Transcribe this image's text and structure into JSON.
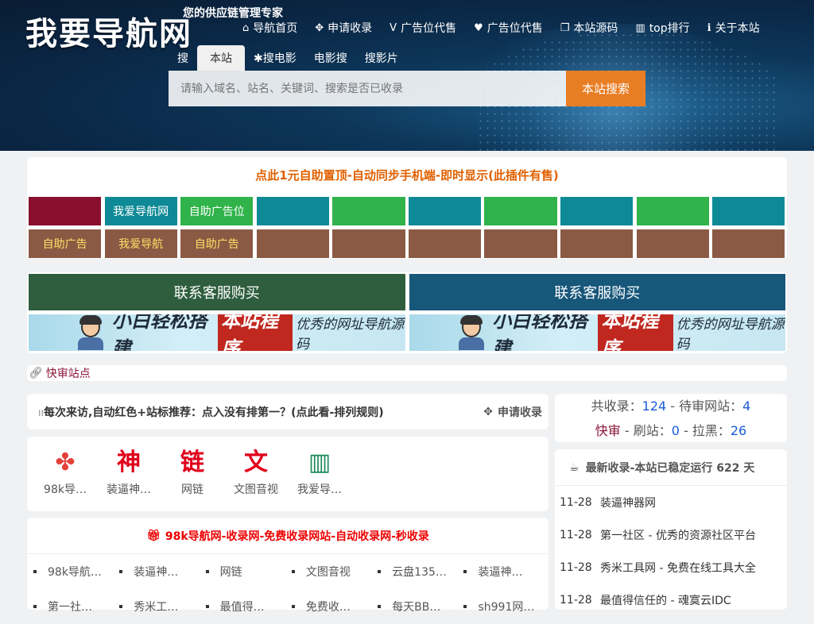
{
  "header": {
    "logo": "我要导航网",
    "slogan": "您的供应链管理专家",
    "nav": [
      {
        "icon": "home-icon",
        "glyph": "⌂",
        "label": "导航首页"
      },
      {
        "icon": "move-icon",
        "glyph": "✥",
        "label": "申请收录"
      },
      {
        "icon": "vimeo-icon",
        "glyph": "V",
        "label": "广告位代售"
      },
      {
        "icon": "heart-icon",
        "glyph": "♥",
        "label": "广告位代售"
      },
      {
        "icon": "window-icon",
        "glyph": "❐",
        "label": "本站源码"
      },
      {
        "icon": "chart-icon",
        "glyph": "▥",
        "label": "top排行"
      },
      {
        "icon": "info-icon",
        "glyph": "ℹ",
        "label": "关于本站"
      }
    ],
    "search_tabs": [
      "搜",
      "本站",
      "✱搜电影",
      "电影搜",
      "搜影片"
    ],
    "search_placeholder": "请输入域名、站名、关键词、搜索是否已收录",
    "search_button": "本站搜索"
  },
  "ad_title": "点此1元自助置顶-自动同步手机端-即时显示(此插件有售)",
  "ad_grid": [
    {
      "label": "",
      "color": "#8a0f2e"
    },
    {
      "label": "我爱导航网",
      "color": "#0e8a96"
    },
    {
      "label": "自助广告位",
      "color": "#2fb34a"
    },
    {
      "label": "",
      "color": "#0e8a96"
    },
    {
      "label": "",
      "color": "#2fb34a"
    },
    {
      "label": "",
      "color": "#0e8a96"
    },
    {
      "label": "",
      "color": "#2fb34a"
    },
    {
      "label": "",
      "color": "#0e8a96"
    },
    {
      "label": "",
      "color": "#2fb34a"
    },
    {
      "label": "",
      "color": "#0e8a96"
    },
    {
      "label": "自助广告",
      "color": "#8a5a44"
    },
    {
      "label": "我爱导航",
      "color": "#8a5a44"
    },
    {
      "label": "自助广告",
      "color": "#8a5a44"
    },
    {
      "label": "",
      "color": "#8a5a44"
    },
    {
      "label": "",
      "color": "#8a5a44"
    },
    {
      "label": "",
      "color": "#8a5a44"
    },
    {
      "label": "",
      "color": "#8a5a44"
    },
    {
      "label": "",
      "color": "#8a5a44"
    },
    {
      "label": "",
      "color": "#8a5a44"
    },
    {
      "label": "",
      "color": "#8a5a44"
    }
  ],
  "buy_buttons": [
    {
      "label": "联系客服购买",
      "color": "#2e5e3e"
    },
    {
      "label": "联系客服购买",
      "color": "#17577a"
    }
  ],
  "banner_ads": [
    {
      "t1": "小白轻松搭建",
      "t2": "本站程序",
      "t3": "优秀的网址导航源码"
    },
    {
      "t1": "小白轻松搭建",
      "t2": "本站程序",
      "t3": "优秀的网址导航源码"
    }
  ],
  "fast_review": "快审站点",
  "rule_bar": {
    "text": "每次来访,自动红色+站标推荐：点入没有排第一？",
    "bold": "(点此看-排列规则)",
    "apply": "申请收录"
  },
  "stats": {
    "total_label": "共收录：",
    "total": "124",
    "pending_label": " - 待审网站：",
    "pending": "4",
    "fast_label": "快审",
    "refresh_label": " - 刷站：",
    "refresh": "0",
    "black_label": " - 拉黑：",
    "black": "26"
  },
  "top_sites": [
    {
      "icon": "pinwheel-icon",
      "glyph": "✤",
      "color": "#e5403a",
      "label": "98k导…"
    },
    {
      "icon": "shen-icon",
      "glyph": "神",
      "color": "#e0001b",
      "label": "装逼神…"
    },
    {
      "icon": "chain-icon",
      "glyph": "链",
      "color": "#e0001b",
      "label": "网链"
    },
    {
      "icon": "wen-icon",
      "glyph": "文",
      "color": "#e0001b",
      "label": "文图音视"
    },
    {
      "icon": "bars-icon",
      "glyph": "▥",
      "color": "#1d8a5a",
      "label": "我爱导…"
    }
  ],
  "collect": {
    "title": "98k导航网-收录网-免费收录网站-自动收录网-秒收录",
    "items": [
      "98k导航…",
      "装逼神…",
      "网链",
      "文图音视",
      "云盘135…",
      "装逼神…",
      "第一社…",
      "秀米工…",
      "最值得…",
      "免费收…",
      "每天BB…",
      "sh991网…"
    ]
  },
  "latest": {
    "title": "最新收录-本站已稳定运行 622 天",
    "rows": [
      {
        "date": "11-28",
        "text": "装逼神器网"
      },
      {
        "date": "11-28",
        "text": "第一社区 - 优秀的资源社区平台"
      },
      {
        "date": "11-28",
        "text": "秀米工具网 - 免费在线工具大全"
      },
      {
        "date": "11-28",
        "text": "最值得信任的 - 魂寞云IDC"
      }
    ]
  }
}
